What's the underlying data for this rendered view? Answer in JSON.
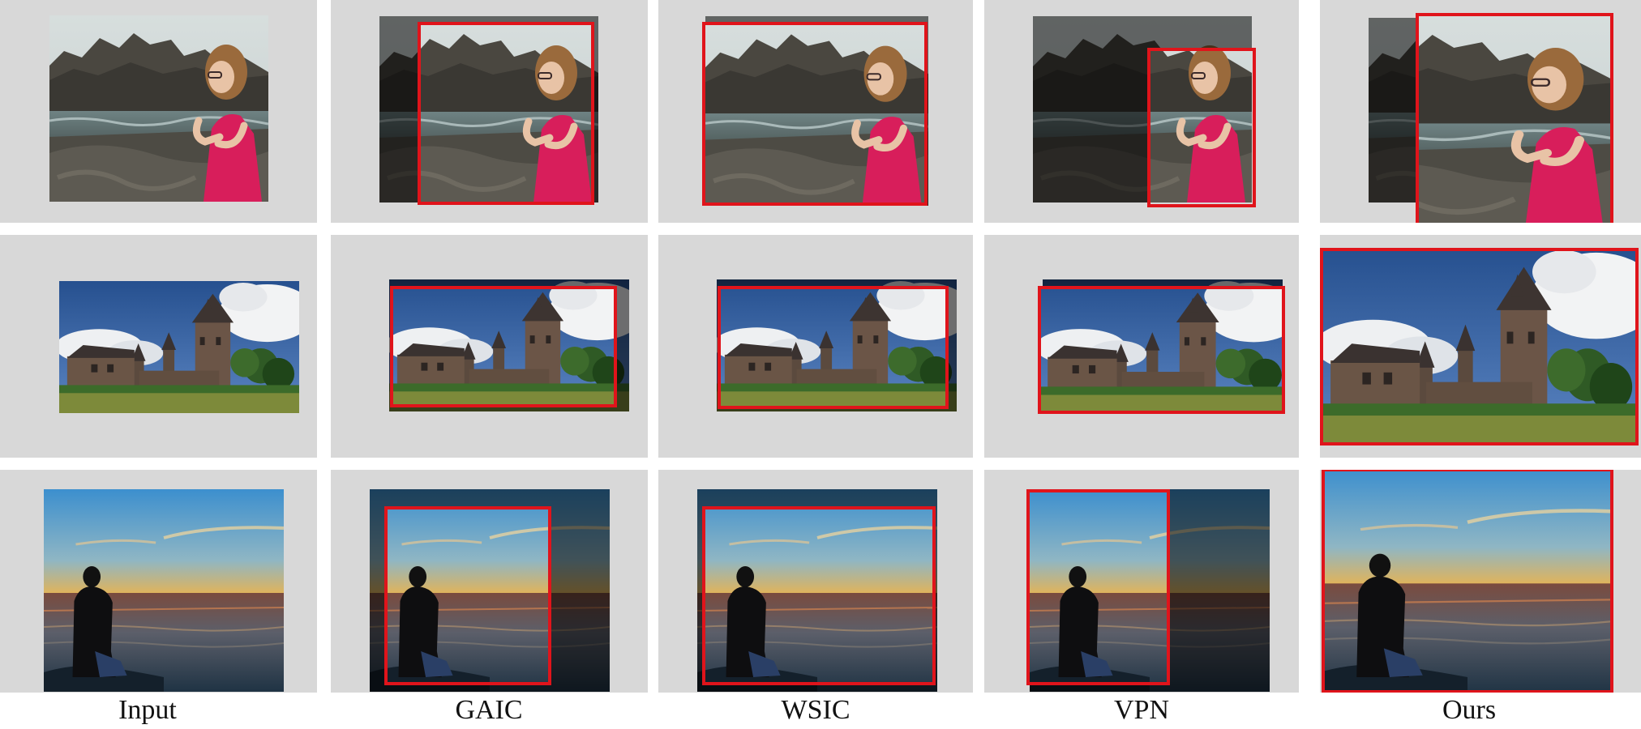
{
  "columns": [
    {
      "label": "Input"
    },
    {
      "label": "GAIC"
    },
    {
      "label": "WSIC"
    },
    {
      "label": "VPN"
    },
    {
      "label": "Ours"
    }
  ],
  "rows": [
    {
      "scene": "girl-on-rocky-shore"
    },
    {
      "scene": "castle-under-cloudy-sky"
    },
    {
      "scene": "man-watching-sunset-over-sea"
    }
  ],
  "colors": {
    "crop_box": "#e0141b",
    "cell_background": "#d8d8d8"
  }
}
